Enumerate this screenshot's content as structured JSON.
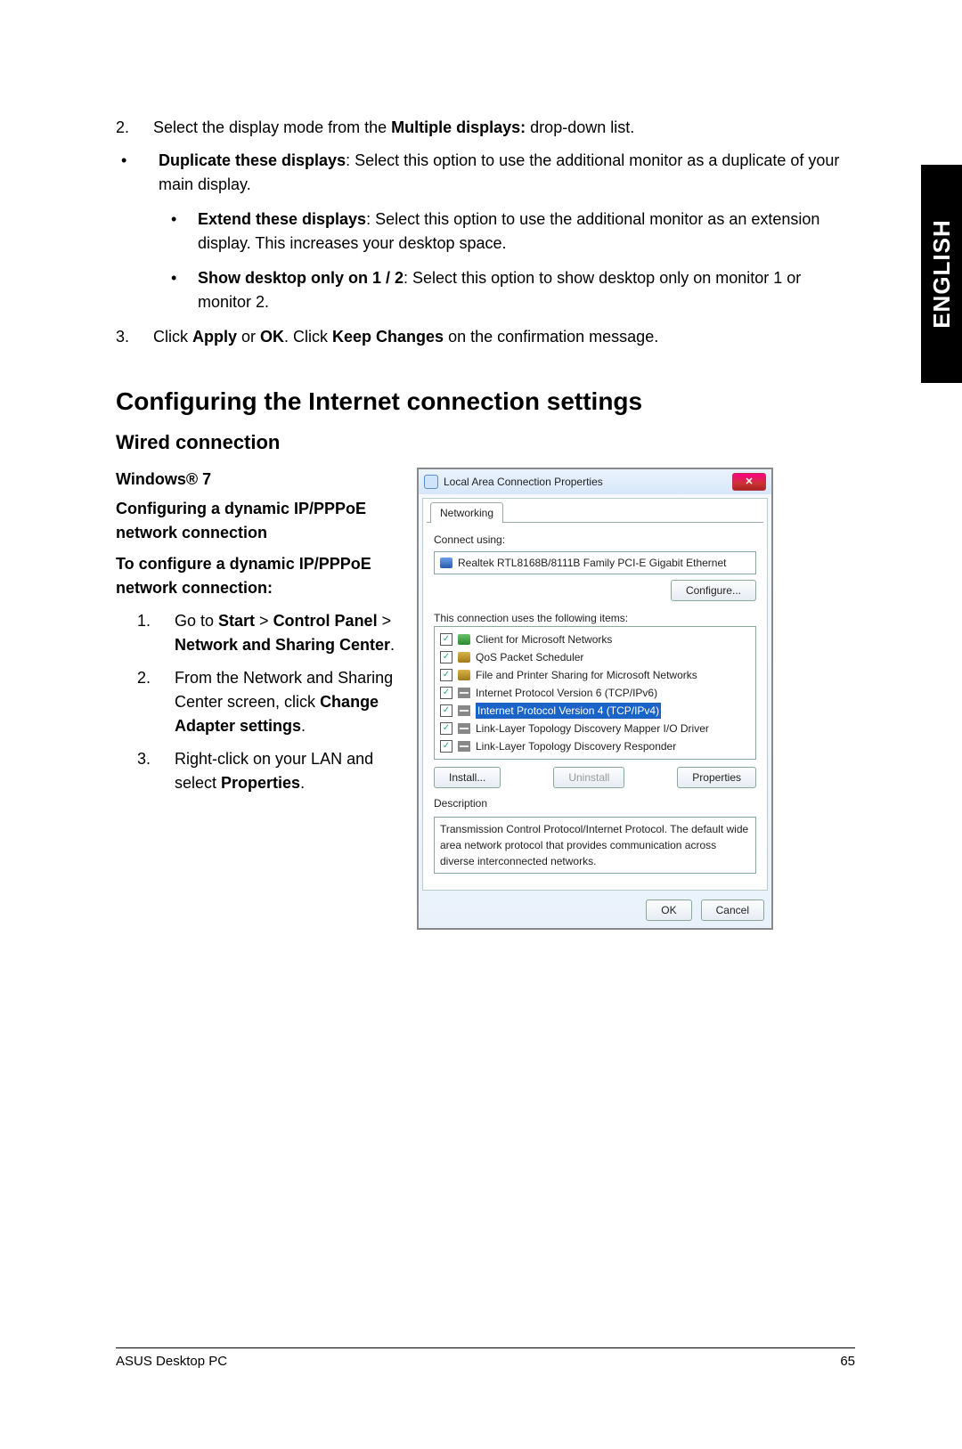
{
  "side_tab": "ENGLISH",
  "top": {
    "step2_num": "2.",
    "step2_pre": "Select the display mode from the ",
    "step2_bold": "Multiple displays:",
    "step2_post": " drop-down list.",
    "b1_bold": "Duplicate these displays",
    "b1_rest": ": Select this option to use the additional monitor as a duplicate of your main display.",
    "b2_bold": "Extend these displays",
    "b2_rest": ": Select this option to use the additional monitor as an extension display. This increases your desktop space.",
    "b3_bold": "Show desktop only on 1 / 2",
    "b3_rest": ": Select this option to show desktop only on monitor 1 or monitor 2.",
    "step3_num": "3.",
    "step3_a": "Click ",
    "step3_b": "Apply",
    "step3_c": " or ",
    "step3_d": "OK",
    "step3_e": ". Click ",
    "step3_f": "Keep Changes",
    "step3_g": " on the confirmation message."
  },
  "h1": "Configuring the Internet connection settings",
  "h2": "Wired connection",
  "h3a": "Windows® 7",
  "h3b": "Configuring a dynamic IP/PPPoE network connection",
  "lead_bold": "To configure a dynamic IP/PPPoE network connection:",
  "st1_num": "1.",
  "st1_a": "Go to ",
  "st1_b": "Start",
  "st1_c": " > ",
  "st1_d": "Control Panel",
  "st1_e": " > ",
  "st1_f": "Network and Sharing Center",
  "st1_g": ".",
  "st2_num": "2.",
  "st2_a": "From the Network and Sharing Center screen, click ",
  "st2_b": "Change Adapter settings",
  "st2_c": ".",
  "st3_num": "3.",
  "st3_a": "Right-click on your LAN and select ",
  "st3_b": "Properties",
  "st3_c": ".",
  "dlg": {
    "title": "Local Area Connection Properties",
    "close": "✕",
    "tab": "Networking",
    "connect_using": "Connect using:",
    "adapter": "Realtek RTL8168B/8111B Family PCI-E Gigabit Ethernet",
    "configure": "Configure...",
    "items_label": "This connection uses the following items:",
    "items": [
      "Client for Microsoft Networks",
      "QoS Packet Scheduler",
      "File and Printer Sharing for Microsoft Networks",
      "Internet Protocol Version 6 (TCP/IPv6)",
      "Internet Protocol Version 4 (TCP/IPv4)",
      "Link-Layer Topology Discovery Mapper I/O Driver",
      "Link-Layer Topology Discovery Responder"
    ],
    "install": "Install...",
    "uninstall": "Uninstall",
    "properties": "Properties",
    "desc_label": "Description",
    "desc": "Transmission Control Protocol/Internet Protocol. The default wide area network protocol that provides communication across diverse interconnected networks.",
    "ok": "OK",
    "cancel": "Cancel"
  },
  "footer_left": "ASUS Desktop PC",
  "footer_right": "65"
}
